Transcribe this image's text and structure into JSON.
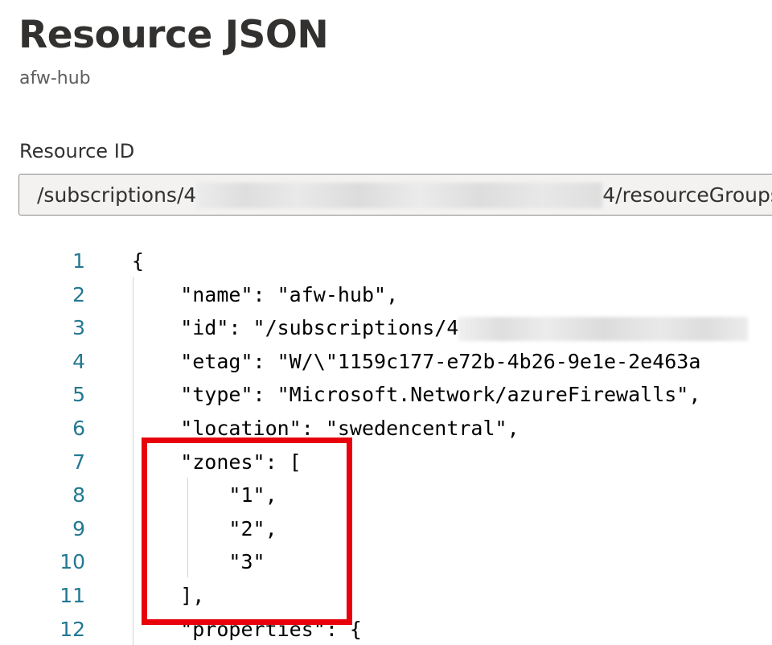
{
  "header": {
    "title": "Resource JSON",
    "subtitle": "afw-hub"
  },
  "resource_id": {
    "label": "Resource ID",
    "value_prefix": "/subscriptions/4",
    "value_suffix": "4/resourceGroups"
  },
  "editor": {
    "lines": [
      {
        "num": "1",
        "text": "{"
      },
      {
        "num": "2",
        "text": "    \"name\": \"afw-hub\","
      },
      {
        "num": "3",
        "text": "    \"id\": \"/subscriptions/4"
      },
      {
        "num": "4",
        "text": "    \"etag\": \"W/\\\"1159c177-e72b-4b26-9e1e-2e463a"
      },
      {
        "num": "5",
        "text": "    \"type\": \"Microsoft.Network/azureFirewalls\","
      },
      {
        "num": "6",
        "text": "    \"location\": \"swedencentral\","
      },
      {
        "num": "7",
        "text": "    \"zones\": ["
      },
      {
        "num": "8",
        "text": "        \"1\","
      },
      {
        "num": "9",
        "text": "        \"2\","
      },
      {
        "num": "10",
        "text": "        \"3\""
      },
      {
        "num": "11",
        "text": "    ],"
      },
      {
        "num": "12",
        "text": "    \"properties\": {"
      }
    ]
  },
  "colors": {
    "line_number": "#237893",
    "highlight_box": "#e8000b",
    "input_background": "#f3f2f1"
  }
}
